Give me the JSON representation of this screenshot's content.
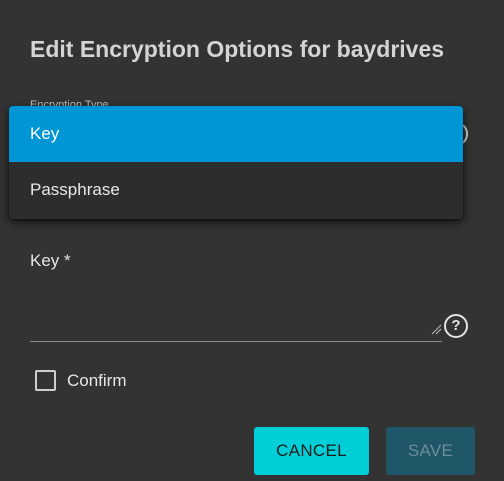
{
  "dialog": {
    "title": "Edit Encryption Options for baydrives",
    "encryption_type_label": "Encryption Type",
    "dropdown": {
      "options": [
        {
          "label": "Key",
          "selected": true
        },
        {
          "label": "Passphrase",
          "selected": false
        }
      ]
    },
    "key_field": {
      "label": "Key *",
      "value": ""
    },
    "confirm": {
      "label": "Confirm",
      "checked": false
    },
    "buttons": {
      "cancel": "CANCEL",
      "save": "SAVE"
    },
    "help_icon_glyph": "?",
    "colors": {
      "background": "#333333",
      "selected_option": "#0095d5",
      "cancel_button": "#00cfd8",
      "save_button_disabled": "#1f5668"
    }
  }
}
